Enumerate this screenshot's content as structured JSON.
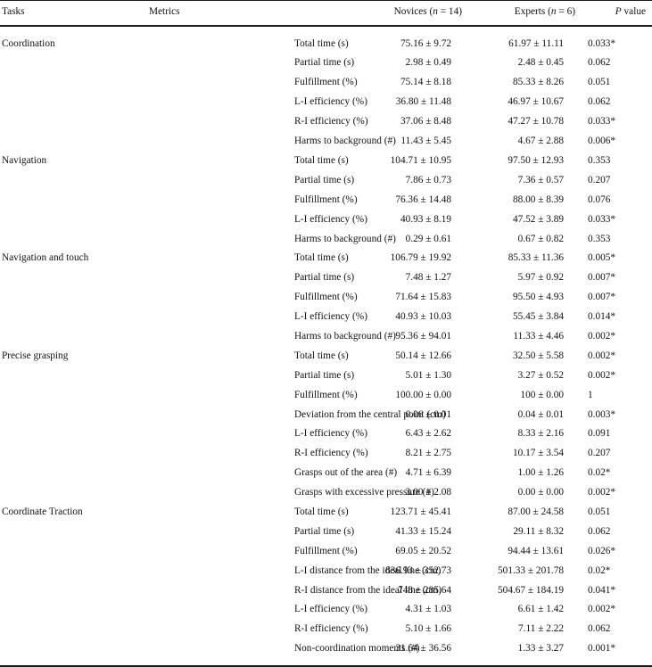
{
  "table": {
    "columns": [
      {
        "key": "task",
        "label": "Tasks",
        "align": "left"
      },
      {
        "key": "metric",
        "label": "Metrics",
        "align": "left"
      },
      {
        "key": "novice",
        "label": "Novices (n = 14)",
        "label_prefix": "Novices (",
        "label_italic": "n",
        "label_suffix": " = 14)",
        "align": "right"
      },
      {
        "key": "expert",
        "label": "Experts (n = 6)",
        "label_prefix": "Experts (",
        "label_italic": "n",
        "label_suffix": " = 6)",
        "align": "right"
      },
      {
        "key": "pvalue",
        "label": "P value",
        "label_italic": "P",
        "label_suffix": " value",
        "align": "right"
      }
    ],
    "sections": [
      {
        "task": "Coordination",
        "rows": [
          {
            "metric": "Total time (s)",
            "novice": "75.16 ± 9.72",
            "expert": "61.97 ± 11.11",
            "pvalue": "0.033*"
          },
          {
            "metric": "Partial time (s)",
            "novice": "2.98 ± 0.49",
            "expert": "2.48 ± 0.45",
            "pvalue": "0.062"
          },
          {
            "metric": "Fulfillment (%)",
            "novice": "75.14 ± 8.18",
            "expert": "85.33 ± 8.26",
            "pvalue": "0.051"
          },
          {
            "metric": "L-I efficiency (%)",
            "novice": "36.80 ± 11.48",
            "expert": "46.97 ± 10.67",
            "pvalue": "0.062"
          },
          {
            "metric": "R-I efficiency (%)",
            "novice": "37.06 ± 8.48",
            "expert": "47.27 ± 10.78",
            "pvalue": "0.033*"
          },
          {
            "metric": "Harms to background (#)",
            "novice": "11.43 ± 5.45",
            "expert": "4.67 ± 2.88",
            "pvalue": "0.006*"
          }
        ]
      },
      {
        "task": "Navigation",
        "rows": [
          {
            "metric": "Total time (s)",
            "novice": "104.71 ± 10.95",
            "expert": "97.50 ± 12.93",
            "pvalue": "0.353"
          },
          {
            "metric": "Partial time (s)",
            "novice": "7.86 ± 0.73",
            "expert": "7.36 ± 0.57",
            "pvalue": "0.207"
          },
          {
            "metric": "Fulfillment (%)",
            "novice": "76.36 ± 14.48",
            "expert": "88.00 ± 8.39",
            "pvalue": "0.076"
          },
          {
            "metric": "L-I efficiency (%)",
            "novice": "40.93 ± 8.19",
            "expert": "47.52 ± 3.89",
            "pvalue": "0.033*"
          },
          {
            "metric": "Harms to background (#)",
            "novice": "0.29 ± 0.61",
            "expert": "0.67 ± 0.82",
            "pvalue": "0.353"
          }
        ]
      },
      {
        "task": "Navigation and touch",
        "rows": [
          {
            "metric": "Total time (s)",
            "novice": "106.79 ± 19.92",
            "expert": "85.33 ± 11.36",
            "pvalue": "0.005*"
          },
          {
            "metric": "Partial time (s)",
            "novice": "7.48 ± 1.27",
            "expert": "5.97 ± 0.92",
            "pvalue": "0.007*"
          },
          {
            "metric": "Fulfillment (%)",
            "novice": "71.64 ± 15.83",
            "expert": "95.50 ± 4.93",
            "pvalue": "0.007*"
          },
          {
            "metric": "L-I efficiency (%)",
            "novice": "40.93 ± 10.03",
            "expert": "55.45 ± 3.84",
            "pvalue": "0.014*"
          },
          {
            "metric": "Harms to background (#)",
            "novice": "95.36 ± 94.01",
            "expert": "11.33 ± 4.46",
            "pvalue": "0.002*"
          }
        ]
      },
      {
        "task": "Precise grasping",
        "rows": [
          {
            "metric": "Total time (s)",
            "novice": "50.14 ± 12.66",
            "expert": "32.50 ± 5.58",
            "pvalue": "0.002*"
          },
          {
            "metric": "Partial time (s)",
            "novice": "5.01 ± 1.30",
            "expert": "3.27 ± 0.52",
            "pvalue": "0.002*"
          },
          {
            "metric": "Fulfillment (%)",
            "novice": "100.00 ± 0.00",
            "expert": "100 ± 0.00",
            "pvalue": "1"
          },
          {
            "metric": "Deviation from the central point (cm)",
            "novice": "0.06 ± 0.01",
            "expert": "0.04 ± 0.01",
            "pvalue": "0.003*"
          },
          {
            "metric": "L-I efficiency (%)",
            "novice": "6.43 ± 2.62",
            "expert": "8.33 ± 2.16",
            "pvalue": "0.091"
          },
          {
            "metric": "R-I efficiency (%)",
            "novice": "8.21 ± 2.75",
            "expert": "10.17 ± 3.54",
            "pvalue": "0.207"
          },
          {
            "metric": "Grasps out of the area (#)",
            "novice": "4.71 ± 6.39",
            "expert": "1.00 ± 1.26",
            "pvalue": "0.02*"
          },
          {
            "metric": "Grasps with excessive pressure (#)",
            "novice": "3.00 ± 2.08",
            "expert": "0.00 ± 0.00",
            "pvalue": "0.002*"
          }
        ]
      },
      {
        "task": "Coordinate Traction",
        "rows": [
          {
            "metric": "Total time (s)",
            "novice": "123.71 ± 45.41",
            "expert": "87.00 ± 24.58",
            "pvalue": "0.051"
          },
          {
            "metric": "Partial time (s)",
            "novice": "41.33 ± 15.24",
            "expert": "29.11 ± 8.32",
            "pvalue": "0.062"
          },
          {
            "metric": "Fulfillment (%)",
            "novice": "69.05 ± 20.52",
            "expert": "94.44 ± 13.61",
            "pvalue": "0.026*"
          },
          {
            "metric": "L-I distance from the ideal line (cm)",
            "novice": "836.93 ± 352.73",
            "expert": "501.33 ± 201.78",
            "pvalue": "0.02*"
          },
          {
            "metric": "R-I distance from the ideal line (cm)",
            "novice": "748 ± 285.64",
            "expert": "504.67 ± 184.19",
            "pvalue": "0.041*"
          },
          {
            "metric": "L-I efficiency (%)",
            "novice": "4.31 ± 1.03",
            "expert": "6.61 ± 1.42",
            "pvalue": "0.002*"
          },
          {
            "metric": "R-I efficiency (%)",
            "novice": "5.10 ± 1.66",
            "expert": "7.11 ± 2.22",
            "pvalue": "0.062"
          },
          {
            "metric": "Non-coordination moments (#)",
            "novice": "31.64 ± 36.56",
            "expert": "1.33 ± 3.27",
            "pvalue": "0.001*"
          }
        ]
      }
    ]
  },
  "style": {
    "rule_color": "#1a1a1a",
    "text_color": "#111111",
    "background": "#ffffff"
  }
}
